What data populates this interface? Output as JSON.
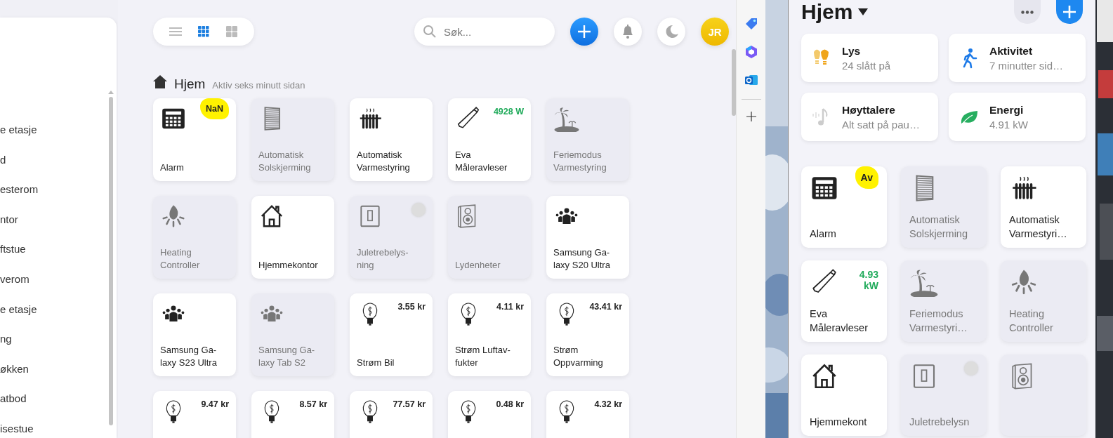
{
  "sidebar": {
    "items": [
      "e etasje",
      "d",
      "esterom",
      "ntor",
      "ftstue",
      "verom",
      "e etasje",
      "ng",
      "økken",
      "atbod",
      "isestue"
    ]
  },
  "main": {
    "view_modes": [
      {
        "kind": "list",
        "selected": false
      },
      {
        "kind": "grid",
        "selected": true
      },
      {
        "kind": "tiles",
        "selected": false
      }
    ],
    "search": {
      "placeholder": "Søk..."
    },
    "avatar": "JR",
    "room": {
      "title": "Hjem",
      "subtitle": "Aktiv seks minutt sidan"
    },
    "tiles": [
      {
        "kind": "keypad",
        "lines": [
          "Alarm"
        ],
        "value": {
          "text": "NaN",
          "kind": "highlight"
        },
        "on": true
      },
      {
        "kind": "blinds",
        "lines": [
          "Automatisk",
          "Solskjerming"
        ],
        "on": false
      },
      {
        "kind": "radiator",
        "lines": [
          "Automatisk",
          "Varmestyring"
        ],
        "on": true
      },
      {
        "kind": "tube",
        "lines": [
          "Eva",
          "Måleravleser"
        ],
        "value": {
          "text": "4928 W",
          "kind": "power"
        },
        "on": true
      },
      {
        "kind": "palm",
        "lines": [
          "Feriemodus",
          "Varmestyring"
        ],
        "on": false
      },
      {
        "kind": "flame",
        "lines": [
          "Heating",
          "Controller"
        ],
        "on": false
      },
      {
        "kind": "house",
        "lines": [
          "Hjemmekontor"
        ],
        "on": true
      },
      {
        "kind": "switch",
        "lines": [
          "Juletrebelys-",
          "ning"
        ],
        "dot": true,
        "on": false
      },
      {
        "kind": "speaker",
        "lines": [
          "Lydenheter"
        ],
        "on": false
      },
      {
        "kind": "people",
        "lines": [
          "Samsung Ga-",
          "laxy S20 Ultra"
        ],
        "on": true
      },
      {
        "kind": "people",
        "lines": [
          "Samsung Ga-",
          "laxy S23 Ultra"
        ],
        "on": true
      },
      {
        "kind": "people",
        "lines": [
          "Samsung Ga-",
          "laxy Tab S2"
        ],
        "on": false
      },
      {
        "kind": "bulb",
        "lines": [
          "Strøm Bil"
        ],
        "value": {
          "text": "3.55 kr",
          "kind": "cost"
        },
        "on": true
      },
      {
        "kind": "bulb",
        "lines": [
          "Strøm Luftav-",
          "fukter"
        ],
        "value": {
          "text": "4.11 kr",
          "kind": "cost"
        },
        "on": true
      },
      {
        "kind": "bulb",
        "lines": [
          "Strøm",
          "Oppvarming"
        ],
        "value": {
          "text": "43.41 kr",
          "kind": "cost"
        },
        "on": true
      },
      {
        "kind": "bulb",
        "value": {
          "text": "9.47 kr",
          "kind": "cost"
        },
        "on": true
      },
      {
        "kind": "bulb",
        "value": {
          "text": "8.57 kr",
          "kind": "cost"
        },
        "on": true
      },
      {
        "kind": "bulb",
        "value": {
          "text": "77.57 kr",
          "kind": "cost"
        },
        "on": true
      },
      {
        "kind": "bulb",
        "value": {
          "text": "0.48 kr",
          "kind": "cost"
        },
        "on": true
      },
      {
        "kind": "bulb",
        "value": {
          "text": "4.32 kr",
          "kind": "cost"
        },
        "on": true
      }
    ]
  },
  "right_window": {
    "title": "Hjem",
    "summary": [
      {
        "kind": "bulbs",
        "title": "Lys",
        "subtitle": "24 slått på"
      },
      {
        "kind": "walker",
        "title": "Aktivitet",
        "subtitle": "7 minutter sid…"
      },
      {
        "kind": "note",
        "title": "Høyttalere",
        "subtitle": "Alt satt på pau…"
      },
      {
        "kind": "leaf",
        "title": "Energi",
        "subtitle": "4.91 kW"
      }
    ],
    "tiles": [
      {
        "kind": "keypad",
        "lines": [
          "Alarm"
        ],
        "value": {
          "text": "Av",
          "kind": "highlight"
        },
        "on": true
      },
      {
        "kind": "blinds",
        "lines": [
          "Automatisk",
          "Solskjerming"
        ],
        "on": false
      },
      {
        "kind": "radiator",
        "lines": [
          "Automatisk",
          "Varmestyri…"
        ],
        "on": true
      },
      {
        "kind": "tube",
        "lines": [
          "Eva",
          "Måleravleser"
        ],
        "value": {
          "text": "4.93 kW",
          "kind": "power"
        },
        "on": true
      },
      {
        "kind": "palm",
        "lines": [
          "Feriemodus",
          "Varmestyri…"
        ],
        "on": false
      },
      {
        "kind": "flame",
        "lines": [
          "Heating",
          "Controller"
        ],
        "on": false
      },
      {
        "kind": "house",
        "lines": [
          "Hjemmekont"
        ],
        "on": true
      },
      {
        "kind": "switch",
        "lines": [
          "Juletrebelysn"
        ],
        "dot": true,
        "on": false
      },
      {
        "kind": "speaker",
        "on": false
      }
    ]
  }
}
